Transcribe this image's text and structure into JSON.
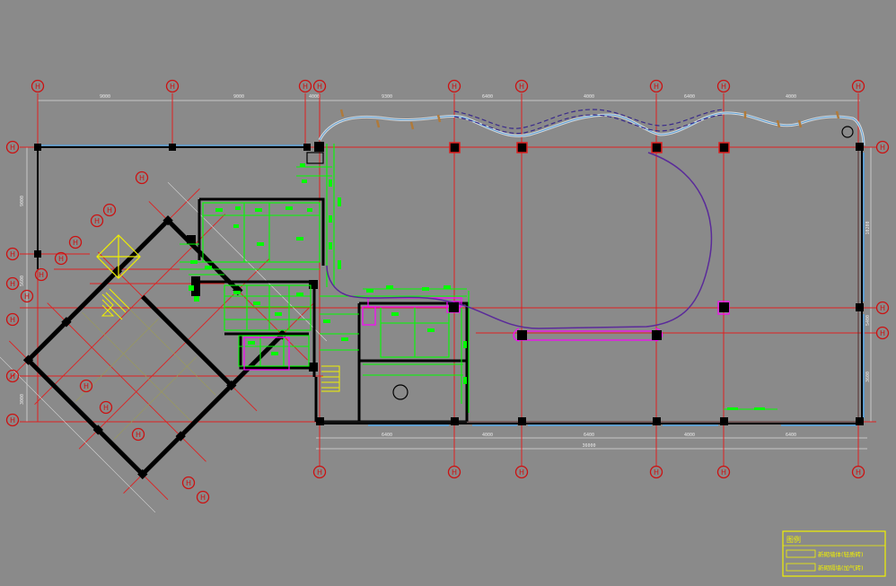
{
  "colors": {
    "background": "#8a8a8a",
    "grid_line": "#e02020",
    "dim_line": "#d8d8d8",
    "wall": "#000000",
    "partition": "#00ff00",
    "curve": "#5a2a9a",
    "dashed": "#3a2a8a",
    "magenta": "#ff00ff",
    "yellow": "#f0f000",
    "bubble": "#cc1111",
    "glass": "#5aa0d8"
  },
  "axis_bubbles": {
    "top": [
      "H",
      "H",
      "H",
      "H",
      "H",
      "H",
      "H",
      "H",
      "H"
    ],
    "bottom": [
      "H",
      "H",
      "H",
      "H",
      "H",
      "H",
      "H"
    ],
    "left": [
      "H",
      "H",
      "H",
      "H",
      "H",
      "H"
    ],
    "right": [
      "H",
      "H",
      "H"
    ],
    "diagonal": [
      "H",
      "H",
      "H",
      "H",
      "H",
      "H",
      "H",
      "H",
      "H",
      "H",
      "H",
      "H"
    ]
  },
  "dimensions": {
    "top": [
      "9000",
      "9000",
      "9300",
      "4000",
      "6400",
      "4000",
      "6400",
      "4000"
    ],
    "bottom": [
      "6400",
      "4000",
      "6400",
      "4000",
      "6400"
    ],
    "bottom_total": "36000",
    "left": [
      "9000",
      "5600",
      "3000"
    ],
    "right": [
      "10200",
      "5400",
      "3600"
    ]
  },
  "legend": {
    "title": "图例",
    "rows": [
      "新砌墙体(轻质砖)",
      "新砌隔墙(加气砖)"
    ]
  }
}
